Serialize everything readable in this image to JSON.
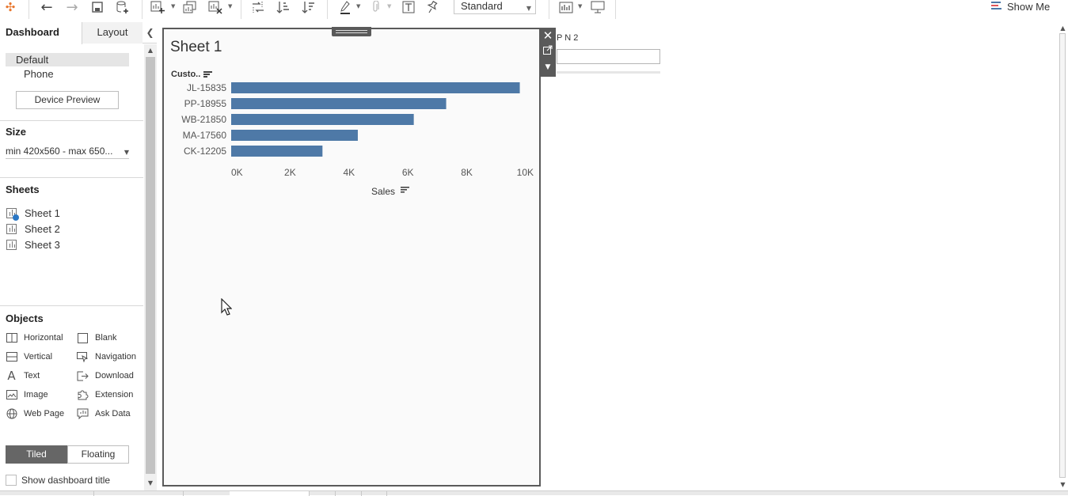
{
  "toolbar": {
    "mark_size_select": "Standard",
    "show_me_label": "Show Me",
    "icons": [
      "tableau-logo-icon",
      "undo-icon",
      "redo-icon",
      "save-icon",
      "new-datasource-icon",
      "new-worksheet-icon",
      "duplicate-sheet-icon",
      "clear-sheet-icon",
      "swap-icon",
      "sort-ascending-icon",
      "sort-descending-icon",
      "highlight-icon",
      "group-icon",
      "label-icon",
      "pin-icon",
      "show-cards-icon",
      "presentation-icon"
    ]
  },
  "left_panel": {
    "tabs": {
      "dashboard": "Dashboard",
      "layout": "Layout"
    },
    "device": {
      "default": "Default",
      "phone": "Phone",
      "preview_button": "Device Preview"
    },
    "size": {
      "title": "Size",
      "value": "min 420x560 - max 650..."
    },
    "sheets": {
      "title": "Sheets",
      "items": [
        {
          "label": "Sheet 1",
          "in_use": true
        },
        {
          "label": "Sheet 2",
          "in_use": false
        },
        {
          "label": "Sheet 3",
          "in_use": false
        }
      ]
    },
    "objects": {
      "title": "Objects",
      "items": [
        {
          "label": "Horizontal",
          "icon": "horizontal-container-icon"
        },
        {
          "label": "Blank",
          "icon": "blank-icon"
        },
        {
          "label": "Vertical",
          "icon": "vertical-container-icon"
        },
        {
          "label": "Navigation",
          "icon": "navigation-icon"
        },
        {
          "label": "Text",
          "icon": "text-icon"
        },
        {
          "label": "Download",
          "icon": "download-icon"
        },
        {
          "label": "Image",
          "icon": "image-icon"
        },
        {
          "label": "Extension",
          "icon": "extension-icon"
        },
        {
          "label": "Web Page",
          "icon": "web-page-icon"
        },
        {
          "label": "Ask Data",
          "icon": "ask-data-icon"
        }
      ]
    },
    "layout_mode": {
      "tiled": "Tiled",
      "floating": "Floating",
      "selected": "Tiled"
    },
    "show_title_label": "Show dashboard title"
  },
  "worksheet": {
    "title": "Sheet 1",
    "row_header": "Custo..",
    "selected_border_color": "#5a5a5a"
  },
  "parameter": {
    "label": "P N 2",
    "value": ""
  },
  "chart_data": {
    "type": "bar",
    "orientation": "horizontal",
    "categories": [
      "JL-15835",
      "PP-18955",
      "WB-21850",
      "MA-17560",
      "CK-12205"
    ],
    "values": [
      9800,
      7300,
      6200,
      4300,
      3100
    ],
    "xlabel": "Sales",
    "xlim": [
      0,
      10000
    ],
    "xticks": [
      {
        "value": 0,
        "label": "0K"
      },
      {
        "value": 2000,
        "label": "2K"
      },
      {
        "value": 4000,
        "label": "4K"
      },
      {
        "value": 6000,
        "label": "6K"
      },
      {
        "value": 8000,
        "label": "8K"
      },
      {
        "value": 10000,
        "label": "10K"
      }
    ],
    "bar_color": "#4e79a7",
    "grid": false
  }
}
